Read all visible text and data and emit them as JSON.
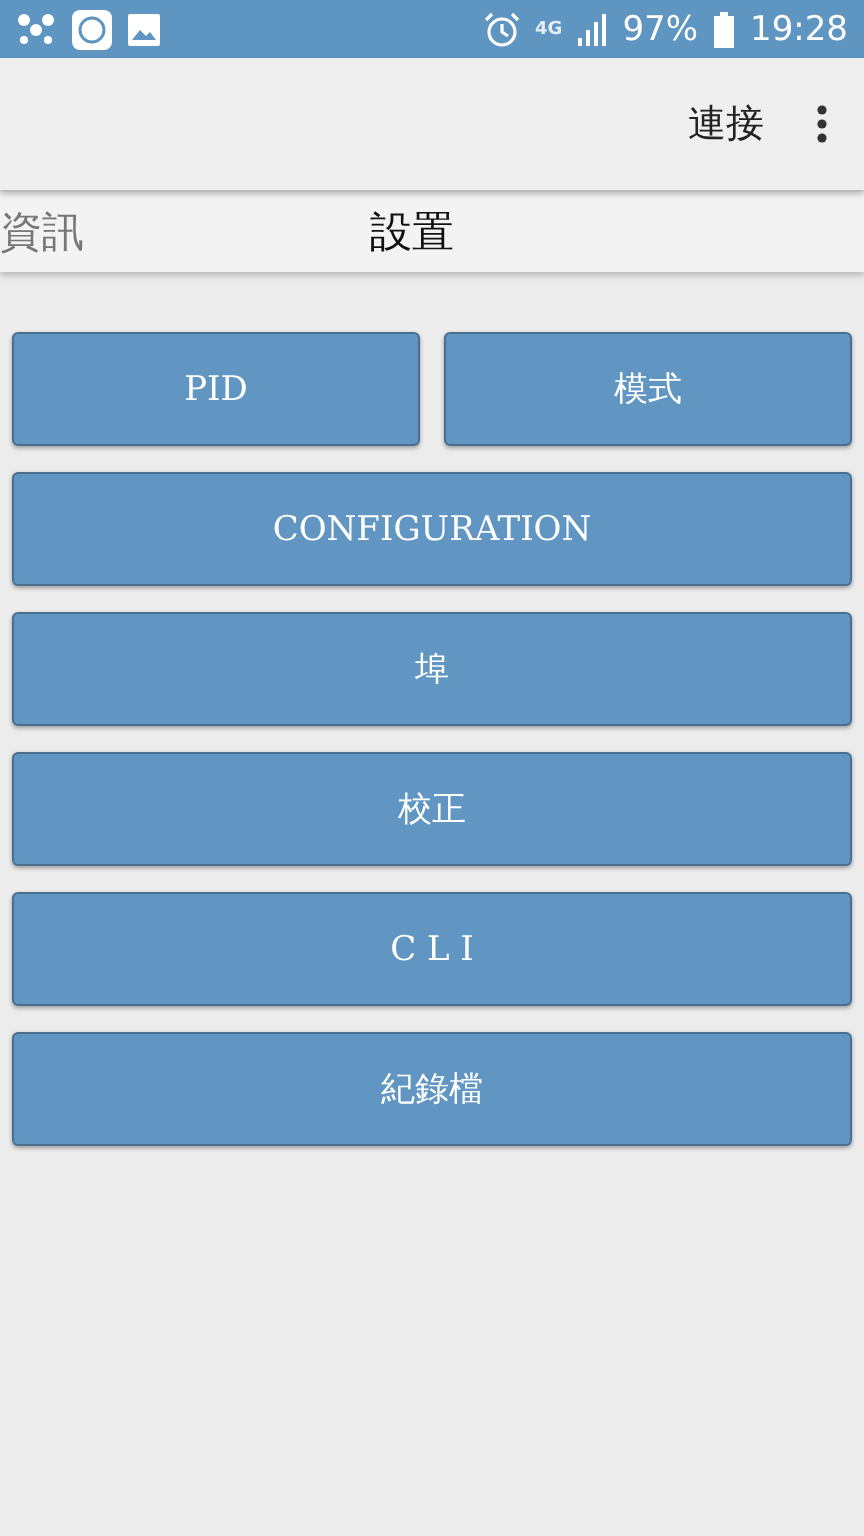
{
  "status_bar": {
    "battery": "97%",
    "time": "19:28",
    "network": "4G"
  },
  "action_bar": {
    "action": "連接"
  },
  "tabs": [
    {
      "label": "資訊",
      "selected": false
    },
    {
      "label": "設置",
      "selected": true
    }
  ],
  "button_rows": [
    [
      "PID",
      "模式"
    ],
    [
      "CONFIGURATION"
    ],
    [
      "埠"
    ],
    [
      "校正"
    ],
    [
      "C L I"
    ],
    [
      "紀錄檔"
    ]
  ]
}
